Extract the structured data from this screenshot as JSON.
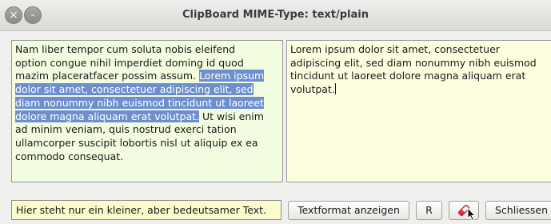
{
  "window": {
    "title": "ClipBoard MIME-Type: text/plain",
    "close_glyph": "×",
    "minimize_glyph": "-"
  },
  "left_text": {
    "before_selection": "Nam liber tempor cum soluta nobis eleifend\noption congue nihil imperdiet doming id quod\nmazim placeratfacer possim assum. ",
    "selection": "Lorem ipsum\ndolor sit amet, consectetuer adipiscing elit, sed\ndiam nonummy nibh euismod tincidunt ut laoreet\ndolore magna aliquam erat volutpat.",
    "after_selection": " Ut wisi enim\nad minim veniam, quis nostrud exerci tation\nullamcorper suscipit lobortis nisl ut aliquip ex ea\ncommodo consequat."
  },
  "right_text": {
    "value": "Lorem ipsum dolor sit amet, consectetuer\nadipiscing elit, sed diam nonummy nibh euismod\ntincidunt ut laoreet dolore magna aliquam erat\nvolutpat."
  },
  "bottom": {
    "info_field_value": "Hier steht nur ein kleiner, aber bedeutsamer Text.",
    "textformat_button": "Textformat anzeigen",
    "r_button": "R",
    "eraser_icon": "eraser-icon",
    "close_button": "Schliessen"
  },
  "colors": {
    "left_bg": "#f2fce0",
    "right_bg": "#fdfde0",
    "selection": "#6d8fcd",
    "info_field_bg": "#fafacc"
  }
}
